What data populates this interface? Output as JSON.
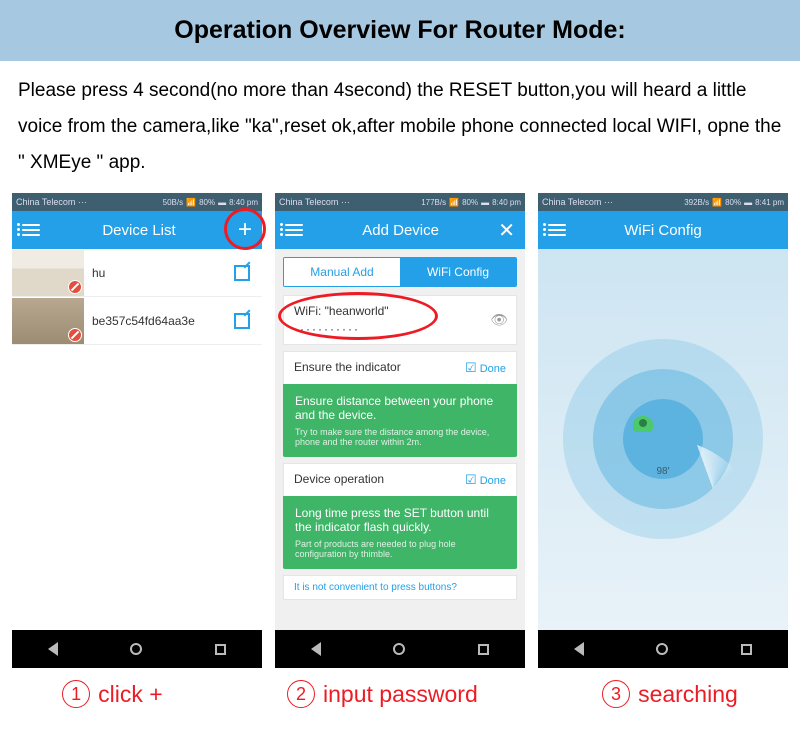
{
  "title": "Operation Overview For Router Mode:",
  "instructions": "Please press 4 second(no more than 4second) the RESET button,you will heard a little voice from the camera,like \"ka\",reset ok,after mobile phone connected local WIFI, opne the \" XMEye \"  app.",
  "phone1": {
    "carrier": "China Telecom ···",
    "speed": "50B/s",
    "battery": "80%",
    "time": "8:40 pm",
    "title": "Device List",
    "devices": [
      {
        "name": "hu"
      },
      {
        "name": "be357c54fd64aa3e"
      }
    ]
  },
  "phone2": {
    "carrier": "China Telecom ···",
    "speed": "177B/s",
    "battery": "80%",
    "time": "8:40 pm",
    "title": "Add Device",
    "tab_manual": "Manual Add",
    "tab_wifi": "WiFi Config",
    "wifi_label": "WiFi: \"heanworld\"",
    "password": "···········",
    "sec1_title": "Ensure the indicator",
    "sec1_done": "Done",
    "sec1_main": "Ensure distance between your phone and the device.",
    "sec1_sub": "Try to make sure the distance among the device, phone and the router within 2m.",
    "sec2_title": "Device operation",
    "sec2_done": "Done",
    "sec2_main": "Long time press the SET button until the indicator flash quickly.",
    "sec2_sub": "Part of products are needed to plug hole configuration by thimble.",
    "cutoff": "It is not convenient to press buttons?"
  },
  "phone3": {
    "carrier": "China Telecom ···",
    "speed": "392B/s",
    "battery": "80%",
    "time": "8:41 pm",
    "title": "WiFi Config",
    "angle": "98'"
  },
  "captions": {
    "c1": "click +",
    "c2": "input password",
    "c3": "searching"
  }
}
